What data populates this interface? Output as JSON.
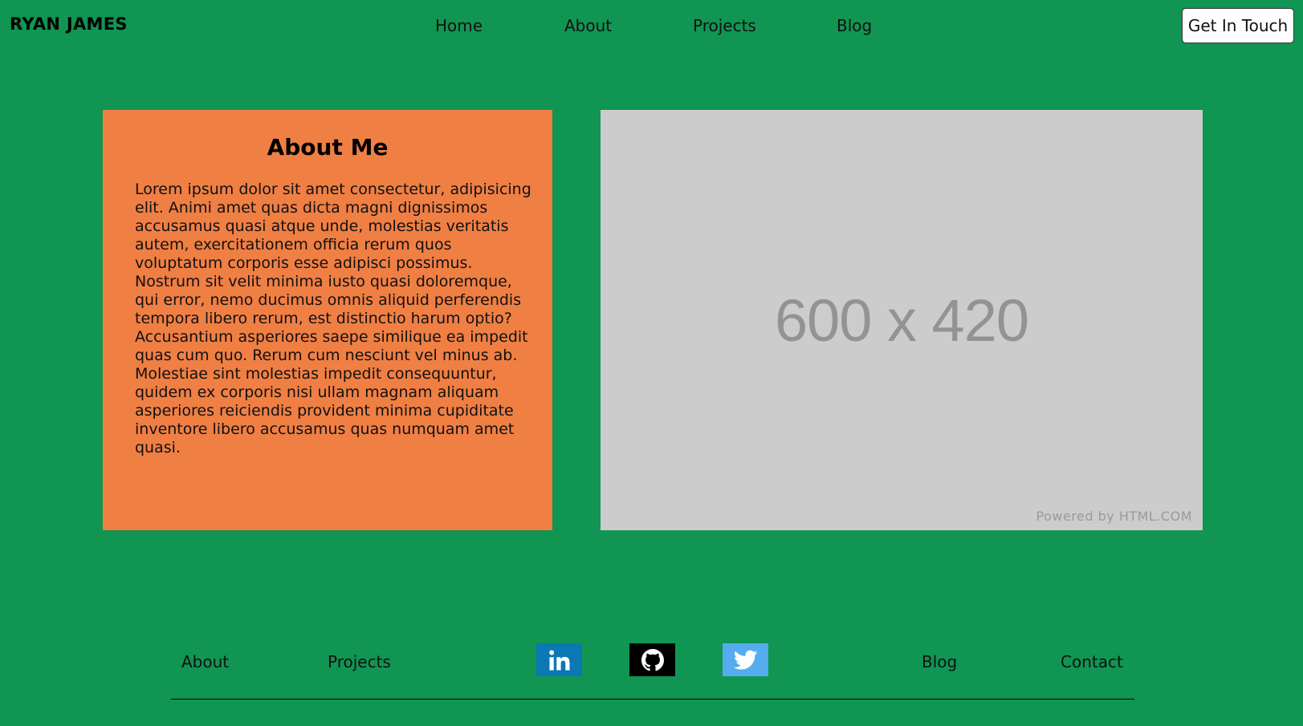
{
  "header": {
    "brand": "RYAN JAMES",
    "nav": [
      "Home",
      "About",
      "Projects",
      "Blog"
    ],
    "cta_label": "Get In Touch"
  },
  "about": {
    "title": "About Me",
    "body": "Lorem ipsum dolor sit amet consectetur, adipisicing elit. Animi amet quas dicta magni dignissimos accusamus quasi atque unde, molestias veritatis autem, exercitationem officia rerum quos voluptatum corporis esse adipisci possimus. Nostrum sit velit minima iusto quasi doloremque, qui error, nemo ducimus omnis aliquid perferendis tempora libero rerum, est distinctio harum optio? Accusantium asperiores saepe similique ea impedit quas cum quo. Rerum cum nesciunt vel minus ab. Molestiae sint molestias impedit consequuntur, quidem ex corporis nisi ullam magnam aliquam asperiores reiciendis provident minima cupiditate inventore libero accusamus quas numquam amet quasi."
  },
  "image_placeholder": {
    "dimensions_text": "600 x 420",
    "powered_by": "Powered by HTML.COM"
  },
  "footer": {
    "links_left": [
      "About",
      "Projects"
    ],
    "links_right": [
      "Blog",
      "Contact"
    ],
    "social_icons": [
      "linkedin-icon",
      "github-icon",
      "twitter-icon"
    ]
  },
  "colors": {
    "page_background": "#109553",
    "about_card": "#f07f44",
    "image_placeholder": "#cccccc",
    "linkedin": "#0b77b5",
    "github": "#000000",
    "twitter": "#55acee"
  }
}
